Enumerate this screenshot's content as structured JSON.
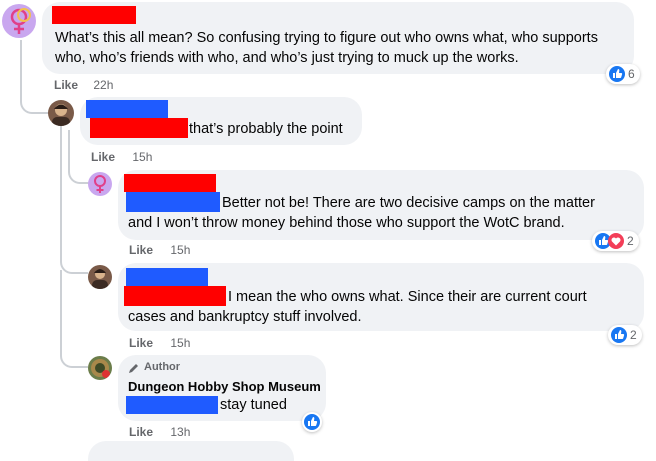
{
  "comments": [
    {
      "id": "c1",
      "text_lines": [
        "What’s this all mean? So confusing trying to figure out who owns what, who supports",
        "who, who’s friends with who, and who’s just trying to muck up the works."
      ],
      "like_label": "Like",
      "time": "22h",
      "reaction_count": "6"
    },
    {
      "id": "c2",
      "text": "that’s probably the point",
      "like_label": "Like",
      "time": "15h"
    },
    {
      "id": "c3",
      "text_lines": [
        "Better not be! There are two decisive camps on the matter",
        "and I won’t throw money behind those who support the WotC brand."
      ],
      "like_label": "Like",
      "time": "15h",
      "reaction_count": "2"
    },
    {
      "id": "c4",
      "text_lines": [
        "I mean the who owns what. Since their are current court",
        "cases and bankruptcy stuff involved."
      ],
      "like_label": "Like",
      "time": "15h",
      "reaction_count": "2"
    },
    {
      "id": "c5",
      "author_tag": "Author",
      "author_name": "Dungeon Hobby Shop Museum",
      "text": "stay tuned",
      "like_label": "Like",
      "time": "13h"
    }
  ],
  "colors": {
    "redaction_red": "#ff0000",
    "redaction_blue": "#1f5bff",
    "bubble": "#f0f2f5",
    "like_blue": "#1877f2",
    "love_red": "#f33e58"
  }
}
